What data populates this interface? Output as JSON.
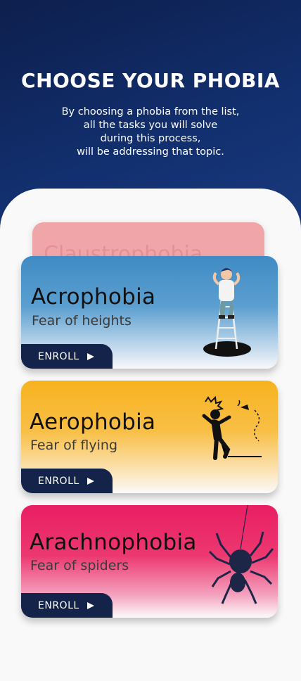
{
  "header": {
    "title": "CHOOSE YOUR PHOBIA",
    "subtitle_lines": [
      "By choosing a phobia from the list,",
      "all the tasks you will solve",
      "during this process,",
      "will be addressing that topic."
    ]
  },
  "back_card": {
    "name": "Claustrophobia"
  },
  "phobias": [
    {
      "name": "Acrophobia",
      "description": "Fear of heights",
      "enroll_label": "ENROLL",
      "illustration": "person-on-ladder-icon",
      "color": "#3f8bc4"
    },
    {
      "name": "Aerophobia",
      "description": "Fear of flying",
      "enroll_label": "ENROLL",
      "illustration": "scared-person-icon",
      "color": "#f7b21f"
    },
    {
      "name": "Arachnophobia",
      "description": "Fear of spiders",
      "enroll_label": "ENROLL",
      "illustration": "spider-icon",
      "color": "#e91e63"
    }
  ],
  "colors": {
    "hero": "#123070",
    "button": "#14234a",
    "back_card": "#f0a5a8"
  }
}
